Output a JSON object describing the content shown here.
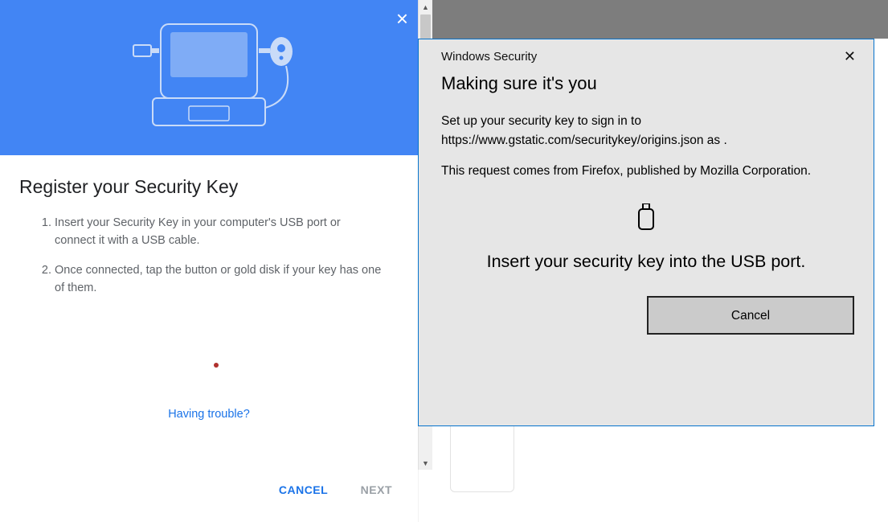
{
  "google_dialog": {
    "title": "Register your Security Key",
    "step1": "Insert your Security Key in your computer's USB port or connect it with a USB cable.",
    "step2": "Once connected, tap the button or gold disk if your key has one of them.",
    "trouble_link": "Having trouble?",
    "cancel_label": "CANCEL",
    "next_label": "NEXT"
  },
  "windows_security": {
    "titlebar": "Windows Security",
    "heading": "Making sure it's you",
    "body1": "Set up your security key to sign in to https://www.gstatic.com/securitykey/origins.json as .",
    "body2": "This request comes from Firefox, published by Mozilla Corporation.",
    "prompt": "Insert your security key into the USB port.",
    "cancel_label": "Cancel"
  }
}
